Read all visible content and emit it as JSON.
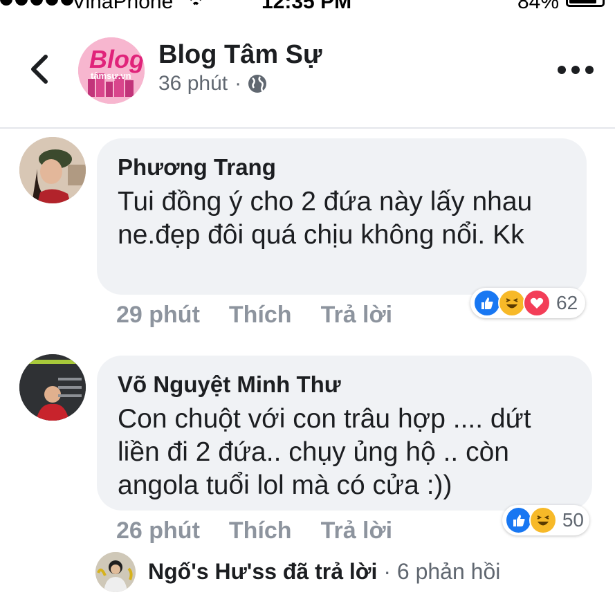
{
  "status_bar": {
    "carrier": "VinaPhone",
    "time": "12:35 PM",
    "battery": "84%",
    "battery_level": 0.84
  },
  "header": {
    "page_name": "Blog Tâm Sự",
    "post_time": "36 phút",
    "separator": "·",
    "avatar_logo_text": "Blog tâmsự.vn",
    "icons": [
      "back-icon",
      "globe-icon",
      "more-icon"
    ]
  },
  "comments": [
    {
      "author": "Phương Trang",
      "text": "Tui đồng ý cho 2 đứa này lấy nhau ne.đẹp đôi quá chịu không nổi. Kk",
      "time": "29 phút",
      "like_label": "Thích",
      "reply_label": "Trả lời",
      "reactions": [
        "like",
        "haha",
        "love"
      ],
      "reaction_count": "62"
    },
    {
      "author": "Võ Nguyệt Minh Thư",
      "text": "Con chuột với con trâu hợp .... dứt liền đi 2 đứa.. chụy ủng hộ .. còn angola tuổi lol mà có cửa :))",
      "time": "26 phút",
      "like_label": "Thích",
      "reply_label": "Trả lời",
      "reactions": [
        "like",
        "haha"
      ],
      "reaction_count": "50"
    }
  ],
  "replies_summary": {
    "name": "Ngố's Hư'ss đã trả lời",
    "separator": "·",
    "count_text": "6 phản hồi"
  },
  "colors": {
    "like_blue": "#1877f2",
    "haha_yellow": "#f7b928",
    "love_red": "#f33e58",
    "bubble_bg": "#f0f2f5",
    "meta_gray": "#8d949e"
  }
}
